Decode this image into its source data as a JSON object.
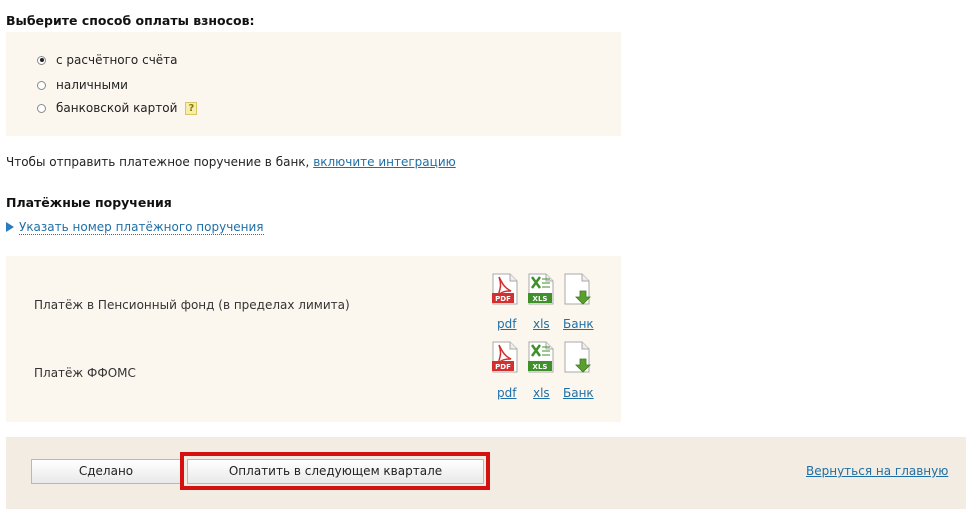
{
  "payment_method": {
    "title": "Выберите способ оплаты взносов:",
    "options": [
      {
        "label": "с расчётного счёта",
        "selected": true
      },
      {
        "label": "наличными",
        "selected": false
      },
      {
        "label": "банковской картой",
        "selected": false
      }
    ],
    "help_glyph": "?"
  },
  "integration": {
    "text": "Чтобы отправить платежное поручение в банк,",
    "link": "включите интеграцию"
  },
  "orders": {
    "title": "Платёжные поручения",
    "specify_link": "Указать номер платёжного поручения",
    "rows": [
      {
        "label": "Платёж в Пенсионный фонд (в пределах лимита)",
        "pdf": "pdf",
        "xls": "xls",
        "bank": "Банк"
      },
      {
        "label": "Платёж ФФОМС",
        "pdf": "pdf",
        "xls": "xls",
        "bank": "Банк"
      }
    ],
    "icon_text": {
      "pdf": "PDF",
      "xls": "XLS"
    },
    "icon_colors": {
      "pdf": "#d32f2f",
      "xls": "#3f8f2a",
      "bank_arrow": "#5aa02c"
    }
  },
  "actions": {
    "done": "Сделано",
    "pay_next": "Оплатить в следующем квартале",
    "back": "Вернуться на главную",
    "highlight_color": "#d41010"
  }
}
